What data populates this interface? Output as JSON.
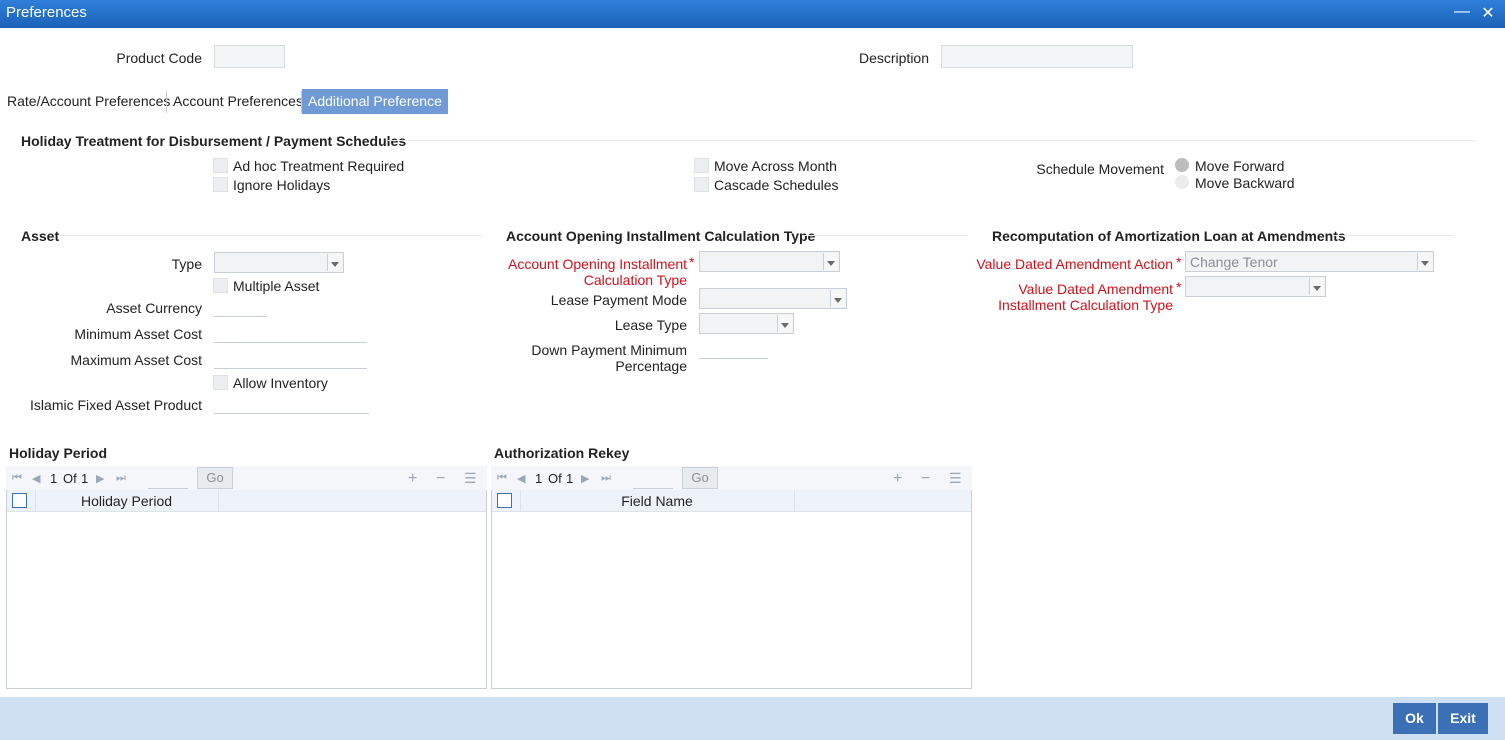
{
  "window": {
    "title": "Preferences"
  },
  "header": {
    "product_code_label": "Product Code",
    "description_label": "Description"
  },
  "tabs": [
    "Rate/Account Preferences",
    "Account Preferences",
    "Additional Preference"
  ],
  "holiday": {
    "title": "Holiday Treatment for Disbursement / Payment Schedules",
    "adhoc": "Ad hoc Treatment Required",
    "ignore": "Ignore Holidays",
    "move_across": "Move Across Month",
    "cascade": "Cascade Schedules",
    "schedule_movement": "Schedule Movement",
    "move_forward": "Move Forward",
    "move_backward": "Move Backward"
  },
  "asset": {
    "title": "Asset",
    "type": "Type",
    "multiple": "Multiple Asset",
    "currency": "Asset Currency",
    "min_cost": "Minimum Asset Cost",
    "max_cost": "Maximum Asset Cost",
    "allow_inventory": "Allow Inventory",
    "islamic": "Islamic Fixed Asset Product"
  },
  "acct_open": {
    "title": "Account Opening Installment Calculation Type",
    "calc_type_line1": "Account Opening Installment",
    "calc_type_line2": "Calculation Type",
    "lease_payment_mode": "Lease Payment Mode",
    "lease_type": "Lease Type",
    "down_payment_line1": "Down Payment Minimum",
    "down_payment_line2": "Percentage"
  },
  "recomp": {
    "title": "Recomputation of Amortization Loan at Amendments",
    "vda_action": "Value Dated Amendment Action",
    "vda_action_value": "Change Tenor",
    "vda_install_line1": "Value Dated Amendment",
    "vda_install_line2": "Installment Calculation Type"
  },
  "holiday_period": {
    "title": "Holiday Period",
    "page": "1",
    "of": "Of",
    "total": "1",
    "go": "Go",
    "column": "Holiday Period"
  },
  "auth_rekey": {
    "title": "Authorization Rekey",
    "page": "1",
    "of": "Of",
    "total": "1",
    "go": "Go",
    "column": "Field Name"
  },
  "footer": {
    "ok": "Ok",
    "exit": "Exit"
  },
  "required_mark": "*"
}
